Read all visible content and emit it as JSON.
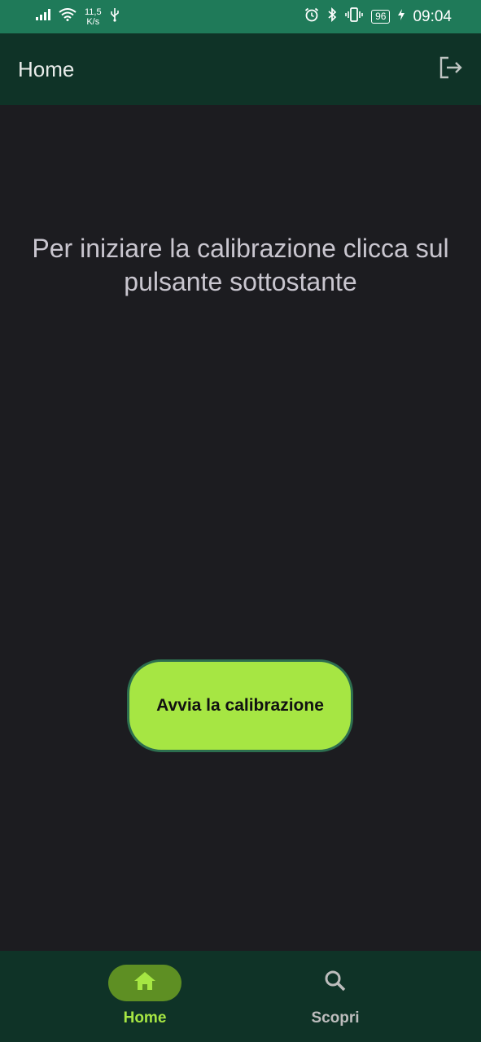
{
  "status_bar": {
    "speed_value": "11,5",
    "speed_unit": "K/s",
    "battery": "96",
    "time": "09:04"
  },
  "app_bar": {
    "title": "Home",
    "logout_icon": "logout-icon"
  },
  "main": {
    "instruction": "Per iniziare la calibrazione clicca sul pulsante sottostante",
    "start_button_label": "Avvia la calibrazione"
  },
  "bottom_nav": {
    "items": [
      {
        "label": "Home",
        "icon": "home-icon",
        "selected": true
      },
      {
        "label": "Scopri",
        "icon": "search-icon",
        "selected": false
      }
    ]
  },
  "colors": {
    "status_bar": "#1f7a59",
    "app_bar": "#0f3327",
    "background": "#1c1c20",
    "accent": "#a6e643",
    "button_border": "#2d6e4f"
  }
}
